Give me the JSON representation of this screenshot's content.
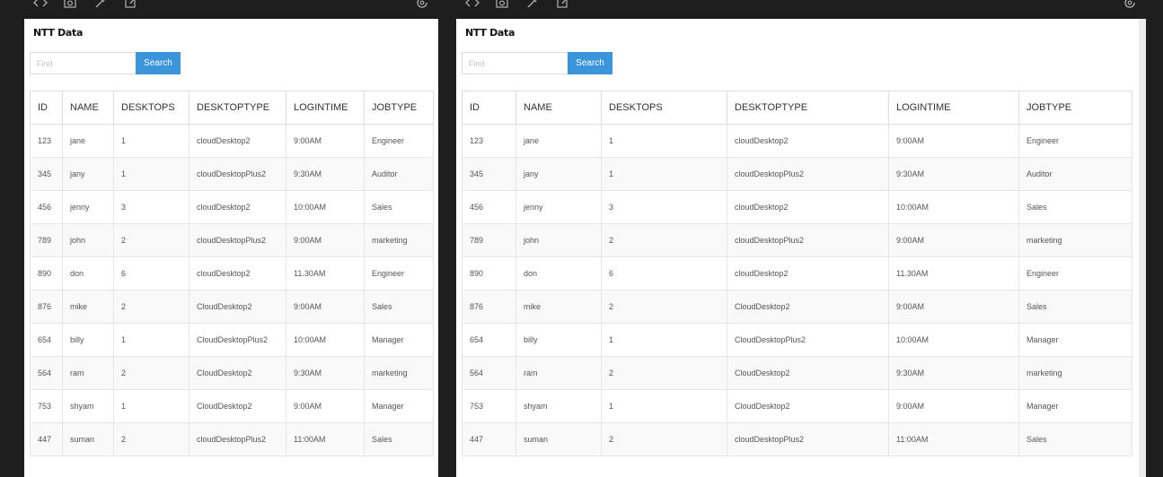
{
  "logo_text": "NTT Data",
  "search": {
    "placeholder": "Find",
    "button_label": "Search"
  },
  "columns": [
    "ID",
    "NAME",
    "DESKTOPS",
    "DESKTOPTYPE",
    "LOGINTIME",
    "JOBTYPE"
  ],
  "rows": [
    [
      "123",
      "jane",
      "1",
      "cloudDesktop2",
      "9:00AM",
      "Engineer"
    ],
    [
      "345",
      "jany",
      "1",
      "cloudDesktopPlus2",
      "9:30AM",
      "Auditor"
    ],
    [
      "456",
      "jenny",
      "3",
      "cloudDesktop2",
      "10:00AM",
      "Sales"
    ],
    [
      "789",
      "john",
      "2",
      "cloudDesktopPlus2",
      "9:00AM",
      "marketing"
    ],
    [
      "890",
      "don",
      "6",
      "cloudDesktop2",
      "11.30AM",
      "Engineer"
    ],
    [
      "876",
      "mike",
      "2",
      "CloudDesktop2",
      "9:00AM",
      "Sales"
    ],
    [
      "654",
      "billy",
      "1",
      "CloudDesktopPlus2",
      "10:00AM",
      "Manager"
    ],
    [
      "564",
      "ram",
      "2",
      "CloudDesktop2",
      "9:30AM",
      "marketing"
    ],
    [
      "753",
      "shyam",
      "1",
      "CloudDesktop2",
      "9:00AM",
      "Manager"
    ],
    [
      "447",
      "suman",
      "2",
      "cloudDesktopPlus2",
      "11:00AM",
      "Sales"
    ]
  ],
  "toolbar_icons": [
    "code-icon",
    "camera-icon",
    "eyedropper-icon",
    "edit-icon",
    "refresh-icon"
  ],
  "colors": {
    "accent": "#3a95dc",
    "background": "#1e1e1e",
    "panel": "#ffffff"
  }
}
